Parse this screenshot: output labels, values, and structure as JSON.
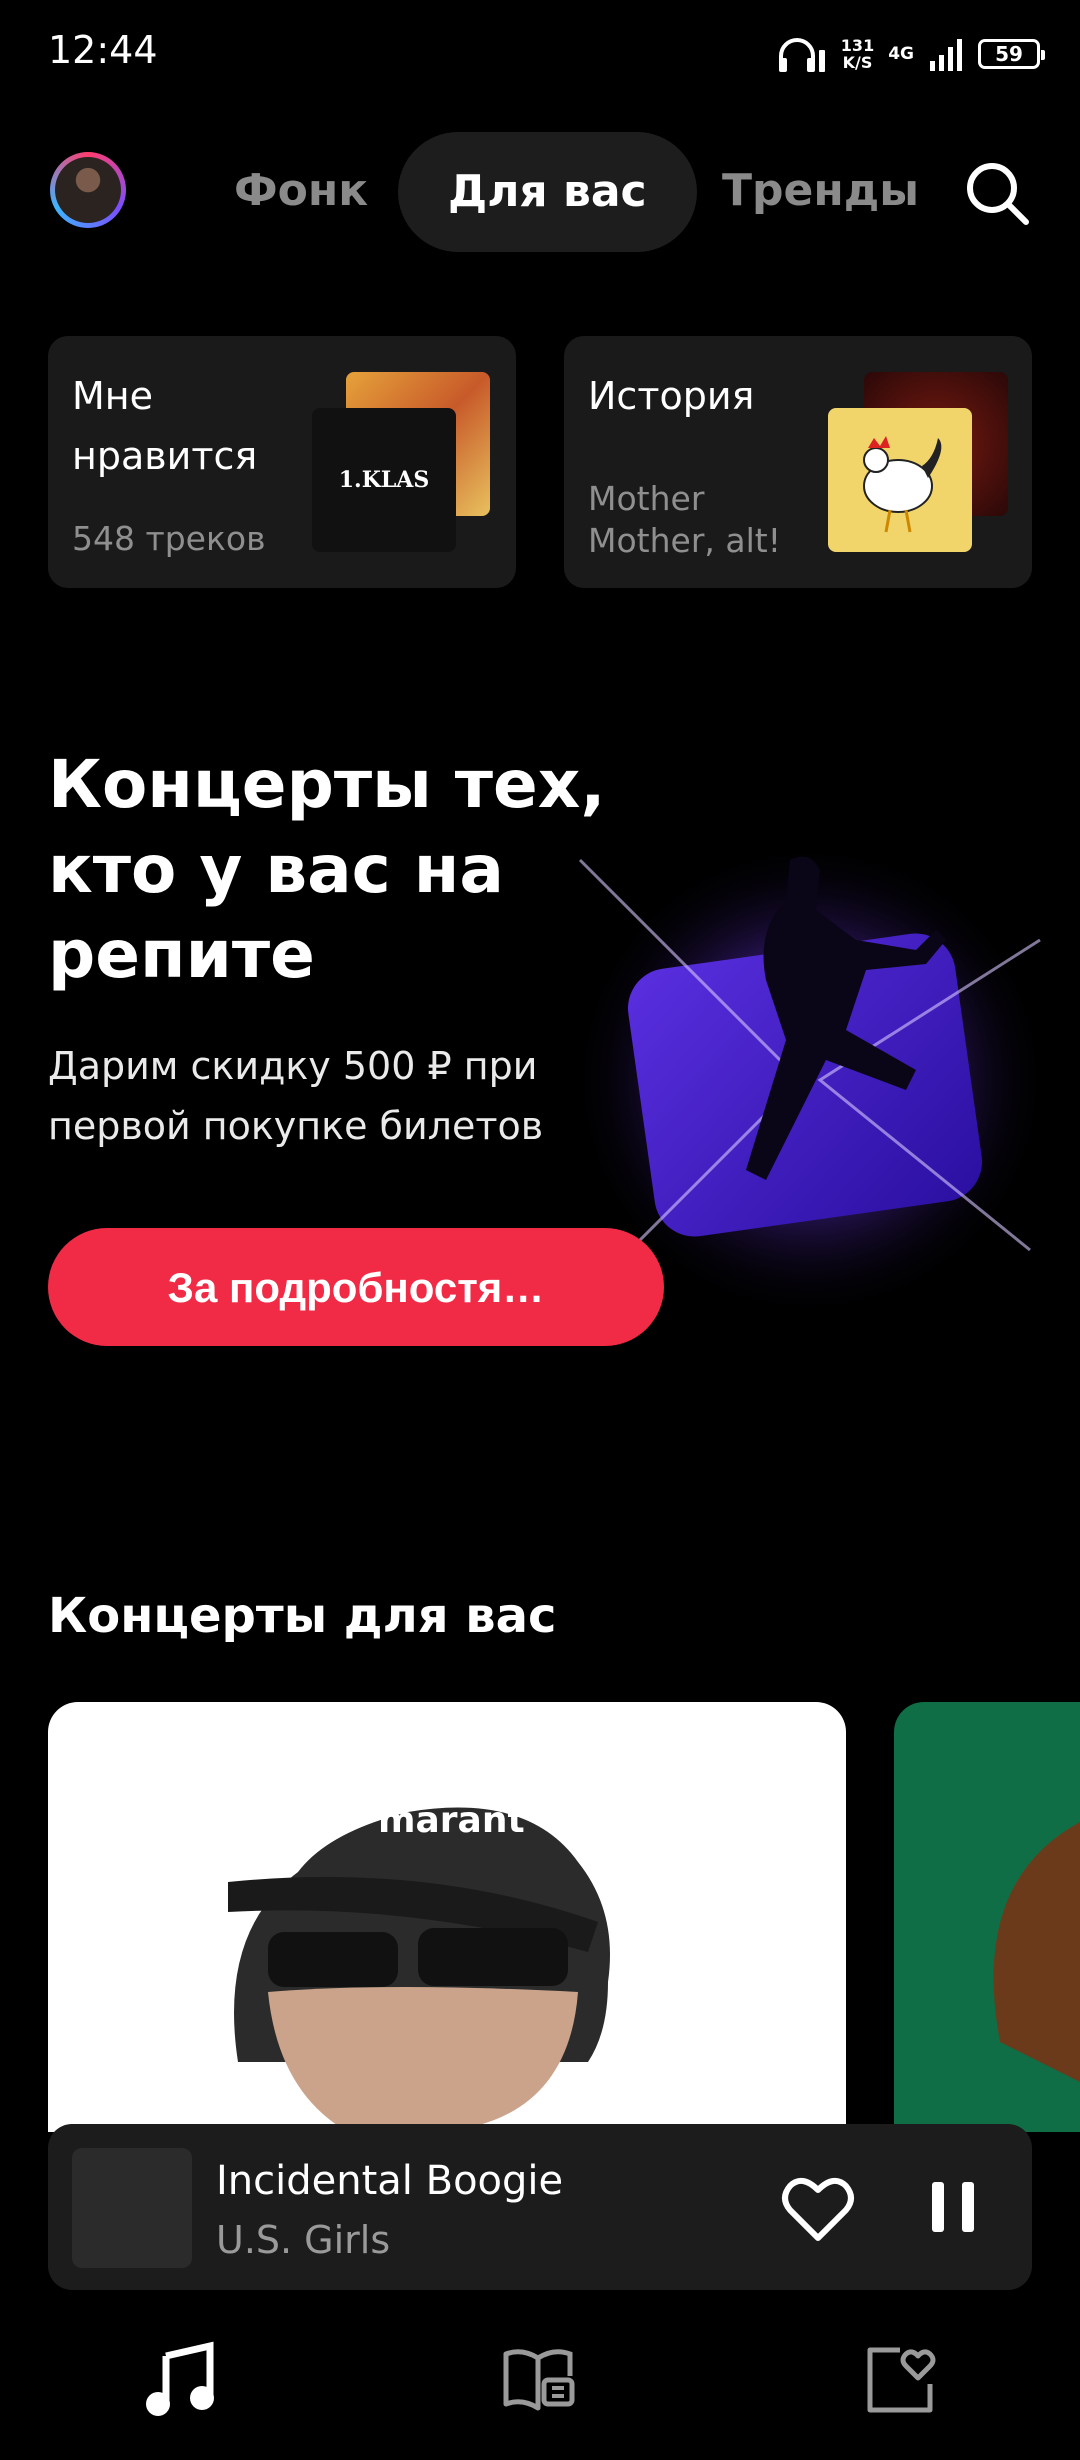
{
  "status": {
    "time": "12:44",
    "net_speed_value": "131",
    "net_speed_unit": "K/S",
    "network": "4G",
    "battery": "59"
  },
  "nav": {
    "tabs": [
      "Фонк",
      "Для вас",
      "Тренды"
    ],
    "active_tab": "Для вас"
  },
  "cards": [
    {
      "title": "Мне нравится",
      "subtitle": "548 треков",
      "cover_text": "1.KLAS"
    },
    {
      "title": "История",
      "subtitle": "Mother Mother, alt!"
    }
  ],
  "promo": {
    "title": "Концерты тех, кто у вас на репите",
    "text": "Дарим скидку 500 ₽ при первой покупке билетов",
    "button_label": "За подробностя…"
  },
  "concerts": {
    "title": "Концерты для вас",
    "cap_text": "marant"
  },
  "player": {
    "title": "Incidental Boogie",
    "artist": "U.S. Girls"
  },
  "colors": {
    "accent": "#f12a46",
    "background": "#000000",
    "card": "#1a1a1a"
  }
}
